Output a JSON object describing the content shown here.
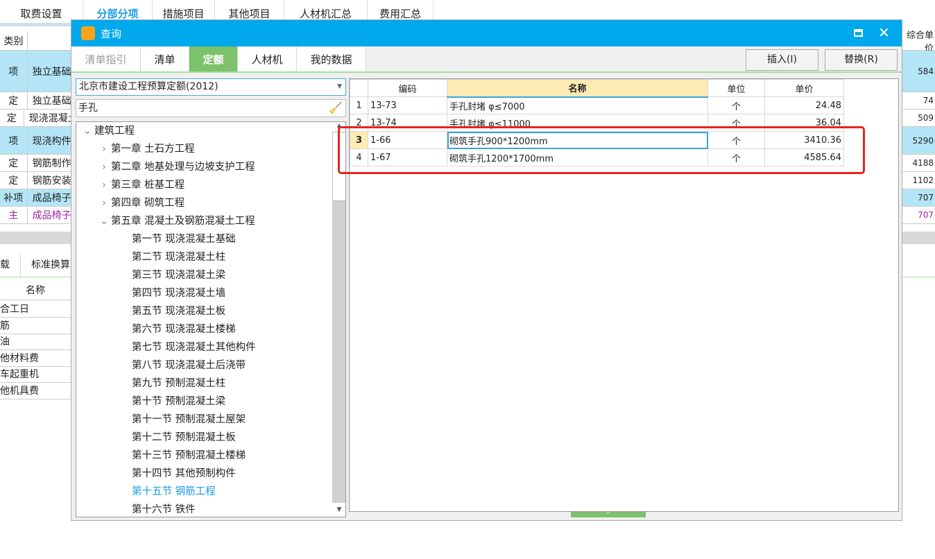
{
  "top_tabs": [
    {
      "label": "取费设置"
    },
    {
      "label": "分部分项",
      "active": true
    },
    {
      "label": "措施项目"
    },
    {
      "label": "其他项目"
    },
    {
      "label": "人材机汇总"
    },
    {
      "label": "费用汇总"
    }
  ],
  "bg_table": {
    "header": "类别",
    "right_header": "综合单价",
    "rows": [
      {
        "type": "项",
        "name": "独立基础",
        "price": "584",
        "blue": true
      },
      {
        "type": "定",
        "name": "独立基础",
        "price": "74"
      },
      {
        "type": "定",
        "name": "现浇混凝土",
        "price": "509"
      },
      {
        "type": "项",
        "name": "现浇构件",
        "price": "5290",
        "blue": true
      },
      {
        "type": "定",
        "name": "钢筋制作",
        "price": "4188"
      },
      {
        "type": "定",
        "name": "钢筋安装",
        "price": "1102"
      },
      {
        "type": "补项",
        "name": "成品椅子",
        "price": "707",
        "blue": true
      },
      {
        "type": "主",
        "name": "成品椅子",
        "price": "707",
        "purple": true
      }
    ]
  },
  "bg_lower": {
    "tabs": [
      "载",
      "标准换算"
    ],
    "header": "名称",
    "rows": [
      "综合工日",
      "钢筋",
      "柴油",
      "其他材料费",
      "汽车起重机",
      "其他机具费"
    ]
  },
  "dialog": {
    "title": "查询",
    "tabs": [
      {
        "label": "清单指引",
        "disabled": true
      },
      {
        "label": "清单"
      },
      {
        "label": "定额",
        "active": true
      },
      {
        "label": "人材机"
      },
      {
        "label": "我的数据"
      }
    ],
    "insert_label": "插入(I)",
    "replace_label": "替换(R)",
    "quota_select": "北京市建设工程预算定额(2012)",
    "search_value": "手孔",
    "tree": [
      {
        "label": "建筑工程",
        "level": 0,
        "expanded": true
      },
      {
        "label": "第一章  土石方工程",
        "level": 1
      },
      {
        "label": "第二章  地基处理与边坡支护工程",
        "level": 1
      },
      {
        "label": "第三章  桩基工程",
        "level": 1
      },
      {
        "label": "第四章  砌筑工程",
        "level": 1
      },
      {
        "label": "第五章  混凝土及钢筋混凝土工程",
        "level": 1,
        "expanded": true
      },
      {
        "label": "第一节  现浇混凝土基础",
        "level": 2
      },
      {
        "label": "第二节  现浇混凝土柱",
        "level": 2
      },
      {
        "label": "第三节  现浇混凝土梁",
        "level": 2
      },
      {
        "label": "第四节  现浇混凝土墙",
        "level": 2
      },
      {
        "label": "第五节  现浇混凝土板",
        "level": 2
      },
      {
        "label": "第六节  现浇混凝土楼梯",
        "level": 2
      },
      {
        "label": "第七节  现浇混凝土其他构件",
        "level": 2
      },
      {
        "label": "第八节  现浇混凝土后浇带",
        "level": 2
      },
      {
        "label": "第九节  预制混凝土柱",
        "level": 2
      },
      {
        "label": "第十节  预制混凝土梁",
        "level": 2
      },
      {
        "label": "第十一节  预制混凝土屋架",
        "level": 2
      },
      {
        "label": "第十二节  预制混凝土板",
        "level": 2
      },
      {
        "label": "第十三节  预制混凝土楼梯",
        "level": 2
      },
      {
        "label": "第十四节  其他预制构件",
        "level": 2
      },
      {
        "label": "第十五节  钢筋工程",
        "level": 2,
        "selected": true
      },
      {
        "label": "第十六节  铁件",
        "level": 2
      }
    ],
    "grid": {
      "columns": [
        "编码",
        "名称",
        "单位",
        "单价"
      ],
      "rows": [
        {
          "no": "1",
          "code": "13-73",
          "name": "手孔封堵 φ≤7000",
          "unit": "个",
          "price": "24.48"
        },
        {
          "no": "2",
          "code": "13-74",
          "name": "手孔封堵 φ≤11000",
          "unit": "个",
          "price": "36.04"
        },
        {
          "no": "3",
          "code": "1-66",
          "name": "砌筑手孔900*1200mm",
          "unit": "个",
          "price": "3410.36",
          "selected": true
        },
        {
          "no": "4",
          "code": "1-67",
          "name": "砌筑手孔1200*1700mm",
          "unit": "个",
          "price": "4585.64"
        }
      ]
    }
  },
  "colors": {
    "title_bar": "#00a8ec",
    "active_tab": "#7dc16b",
    "highlight_box": "#e8231f",
    "tree_selected": "#1a9be6"
  }
}
